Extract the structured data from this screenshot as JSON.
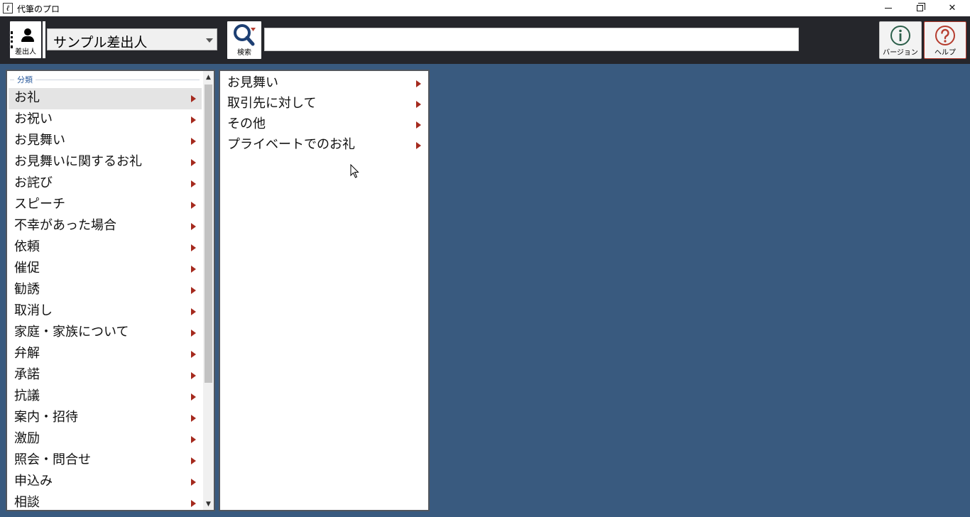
{
  "window": {
    "title": "代筆のプロ",
    "icon_glyph": "ℓ"
  },
  "toolbar": {
    "sender_label": "差出人",
    "sender_selected": "サンプル差出人",
    "search_label": "検索",
    "search_value": "",
    "version_label": "バージョン",
    "help_label": "ヘルプ"
  },
  "categories": {
    "legend": "分類",
    "items": [
      {
        "label": "お礼"
      },
      {
        "label": "お祝い"
      },
      {
        "label": "お見舞い"
      },
      {
        "label": "お見舞いに関するお礼"
      },
      {
        "label": "お詫び"
      },
      {
        "label": "スピーチ"
      },
      {
        "label": "不幸があった場合"
      },
      {
        "label": "依頼"
      },
      {
        "label": "催促"
      },
      {
        "label": "勧誘"
      },
      {
        "label": "取消し"
      },
      {
        "label": "家庭・家族について"
      },
      {
        "label": "弁解"
      },
      {
        "label": "承諾"
      },
      {
        "label": "抗議"
      },
      {
        "label": "案内・招待"
      },
      {
        "label": "激励"
      },
      {
        "label": "照会・問合せ"
      },
      {
        "label": "申込み"
      },
      {
        "label": "相談"
      }
    ],
    "selected_index": 0
  },
  "subcategories": {
    "items": [
      {
        "label": "お見舞い"
      },
      {
        "label": "取引先に対して"
      },
      {
        "label": "その他"
      },
      {
        "label": "プライベートでのお礼"
      }
    ]
  },
  "colors": {
    "background": "#395a7f",
    "toolbar": "#25262b",
    "arrow": "#a52a1e",
    "help_accent": "#b53c2e"
  }
}
